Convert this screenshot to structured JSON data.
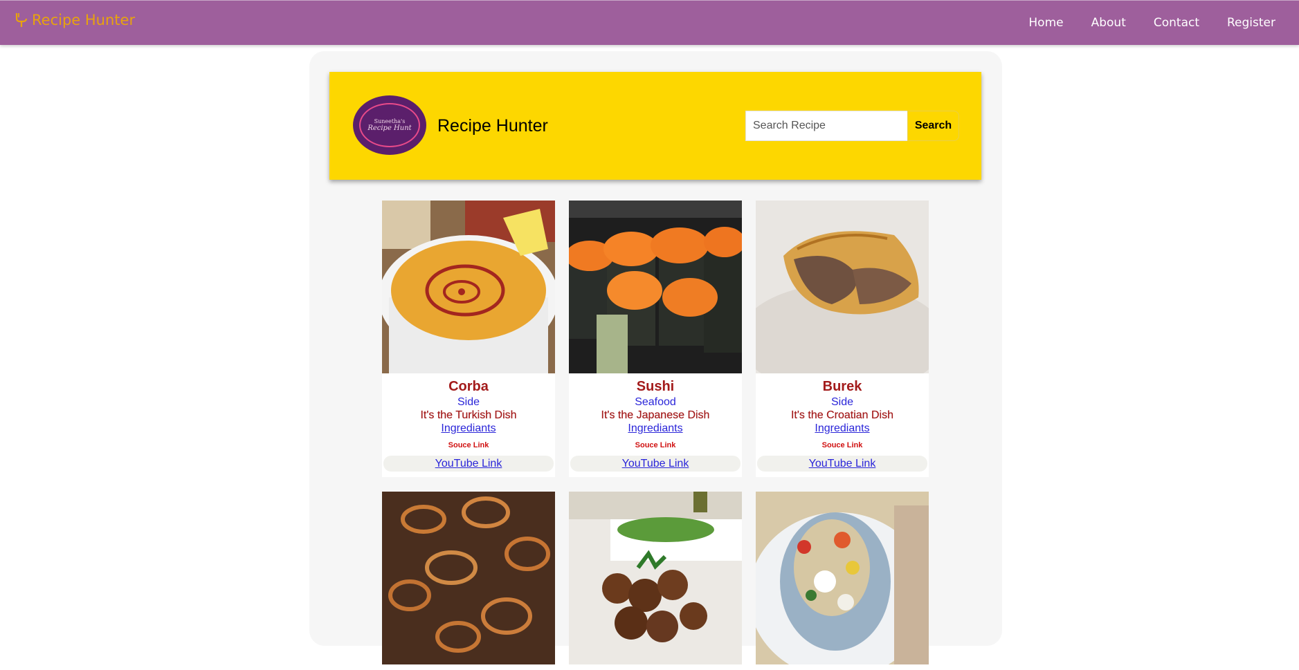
{
  "navbar": {
    "brand": "Recipe Hunter",
    "brand_icon": "fork-spoon-icon",
    "links": [
      "Home",
      "About",
      "Contact",
      "Register"
    ]
  },
  "hero": {
    "logo_line1": "Suneetha's",
    "logo_line2": "Recipe Hunt",
    "title": "Recipe Hunter",
    "search_placeholder": "Search Recipe",
    "search_button": "Search"
  },
  "recipes": [
    {
      "name": "Corba",
      "category": "Side",
      "area": "It's the Turkish Dish",
      "ingredients": "Ingrediants",
      "source": "Souce Link",
      "youtube": "YouTube Link",
      "image": "soup-bowl"
    },
    {
      "name": "Sushi",
      "category": "Seafood",
      "area": "It's the Japanese Dish",
      "ingredients": "Ingrediants",
      "source": "Souce Link",
      "youtube": "YouTube Link",
      "image": "sushi-rolls"
    },
    {
      "name": "Burek",
      "category": "Side",
      "area": "It's the Croatian Dish",
      "ingredients": "Ingrediants",
      "source": "Souce Link",
      "youtube": "YouTube Link",
      "image": "burek-pastry"
    },
    {
      "image": "beef-onions"
    },
    {
      "image": "falafel"
    },
    {
      "image": "pita-salad"
    }
  ],
  "colors": {
    "navbar": "#9e5f9c",
    "brand": "#e8a30e",
    "hero": "#fdd700",
    "dish_name": "#a31b1b",
    "link_blue": "#2a25d9",
    "source_red": "#d01010"
  }
}
